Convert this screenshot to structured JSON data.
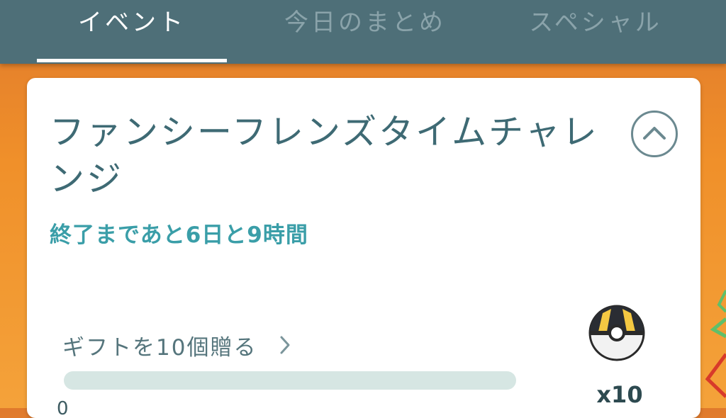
{
  "tabs": [
    {
      "label": "イベント",
      "active": true
    },
    {
      "label": "今日のまとめ",
      "active": false
    },
    {
      "label": "スペシャル",
      "active": false
    }
  ],
  "event": {
    "title": "ファンシーフレンズタイムチャレンジ",
    "time_left": "終了まであと6日と9時間",
    "task": {
      "label": "ギフトを10個贈る",
      "progress_fraction": 0,
      "progress_min": "0"
    },
    "reward": {
      "icon": "ultra-ball-icon",
      "count": "x10"
    }
  },
  "colors": {
    "tabbar": "#4e6f78",
    "title": "#3e6a74",
    "accent": "#3a9ea8",
    "progress_track": "#d6e6e3"
  }
}
